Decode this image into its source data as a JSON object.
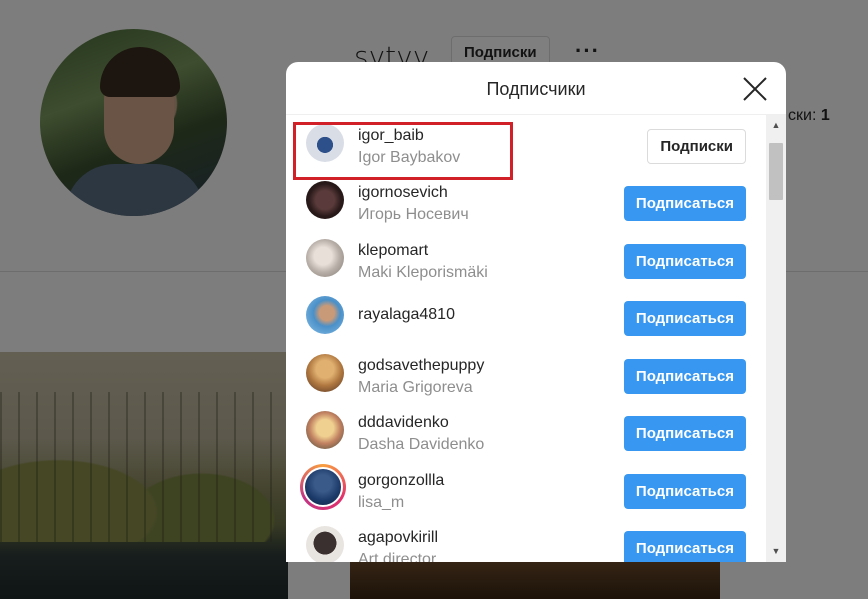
{
  "profile": {
    "username": "svtvv",
    "subscriptions_button": "Подписки",
    "more_label": "···",
    "following_label": "ски:",
    "following_count": "1"
  },
  "modal": {
    "title": "Подписчики",
    "close_icon": "close-icon"
  },
  "followers": [
    {
      "username": "igor_baib",
      "fullname": "Igor Baybakov",
      "button": "Подписки",
      "button_type": "following"
    },
    {
      "username": "igornosevich",
      "fullname": "Игорь Носевич",
      "button": "Подписаться",
      "button_type": "follow"
    },
    {
      "username": "klepomart",
      "fullname": "Maki Kleporismäki",
      "button": "Подписаться",
      "button_type": "follow"
    },
    {
      "username": "rayalaga4810",
      "fullname": "",
      "button": "Подписаться",
      "button_type": "follow"
    },
    {
      "username": "godsavethepuppy",
      "fullname": "Maria Grigoreva",
      "button": "Подписаться",
      "button_type": "follow"
    },
    {
      "username": "dddavidenko",
      "fullname": "Dasha Davidenko",
      "button": "Подписаться",
      "button_type": "follow"
    },
    {
      "username": "gorgonzollla",
      "fullname": "lisa_m",
      "button": "Подписаться",
      "button_type": "follow"
    },
    {
      "username": "agapovkirill",
      "fullname": "Art director",
      "button": "Подписаться",
      "button_type": "follow"
    }
  ],
  "colors": {
    "accent": "#3897f0",
    "highlight": "#d12027"
  }
}
